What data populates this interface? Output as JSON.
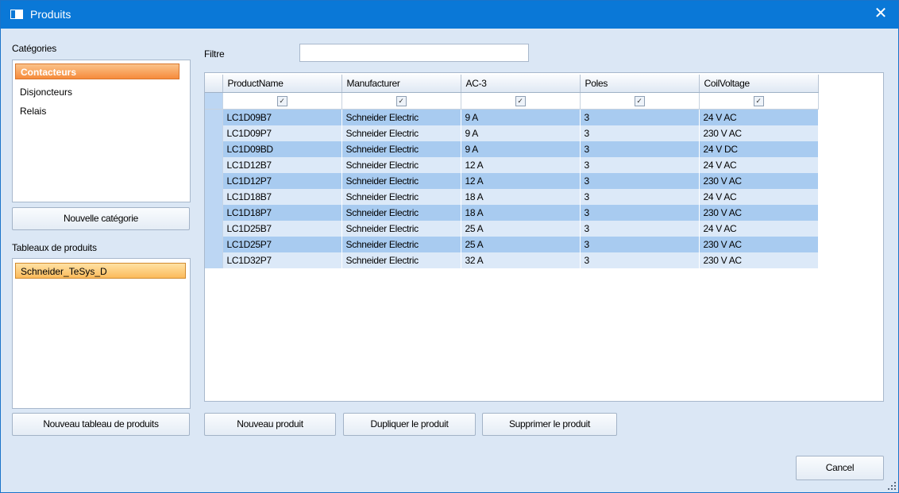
{
  "window": {
    "title": "Produits",
    "close_glyph": "✕"
  },
  "categories": {
    "label": "Catégories",
    "items": [
      "Contacteurs",
      "Disjoncteurs",
      "Relais"
    ],
    "selected": 0,
    "new_button": "Nouvelle catégorie"
  },
  "tables": {
    "label": "Tableaux de produits",
    "items": [
      "Schneider_TeSys_D"
    ],
    "selected": 0,
    "new_button": "Nouveau tableau de produits"
  },
  "filter": {
    "label": "Filtre",
    "value": "",
    "placeholder": ""
  },
  "grid": {
    "columns": [
      "ProductName",
      "Manufacturer",
      "AC-3",
      "Poles",
      "CoilVoltage"
    ],
    "filter_checked": [
      true,
      true,
      true,
      true,
      true
    ],
    "rows": [
      [
        "LC1D09B7",
        "Schneider Electric",
        "9 A",
        "3",
        "24 V AC"
      ],
      [
        "LC1D09P7",
        "Schneider Electric",
        "9 A",
        "3",
        "230 V AC"
      ],
      [
        "LC1D09BD",
        "Schneider Electric",
        "9 A",
        "3",
        "24 V DC"
      ],
      [
        "LC1D12B7",
        "Schneider Electric",
        "12 A",
        "3",
        "24 V AC"
      ],
      [
        "LC1D12P7",
        "Schneider Electric",
        "12 A",
        "3",
        "230 V AC"
      ],
      [
        "LC1D18B7",
        "Schneider Electric",
        "18 A",
        "3",
        "24 V AC"
      ],
      [
        "LC1D18P7",
        "Schneider Electric",
        "18 A",
        "3",
        "230 V AC"
      ],
      [
        "LC1D25B7",
        "Schneider Electric",
        "25 A",
        "3",
        "24 V AC"
      ],
      [
        "LC1D25P7",
        "Schneider Electric",
        "25 A",
        "3",
        "230 V AC"
      ],
      [
        "LC1D32P7",
        "Schneider Electric",
        "32 A",
        "3",
        "230 V AC"
      ]
    ]
  },
  "actions": {
    "new_product": "Nouveau produit",
    "duplicate_product": "Dupliquer le produit",
    "delete_product": "Supprimer le produit",
    "cancel": "Cancel"
  },
  "colors": {
    "titlebar": "#0a78d7",
    "window_bg": "#dbe7f5",
    "selection": "#f68b3b",
    "row_odd": "#a8cbf0",
    "row_even": "#dce9f8"
  }
}
